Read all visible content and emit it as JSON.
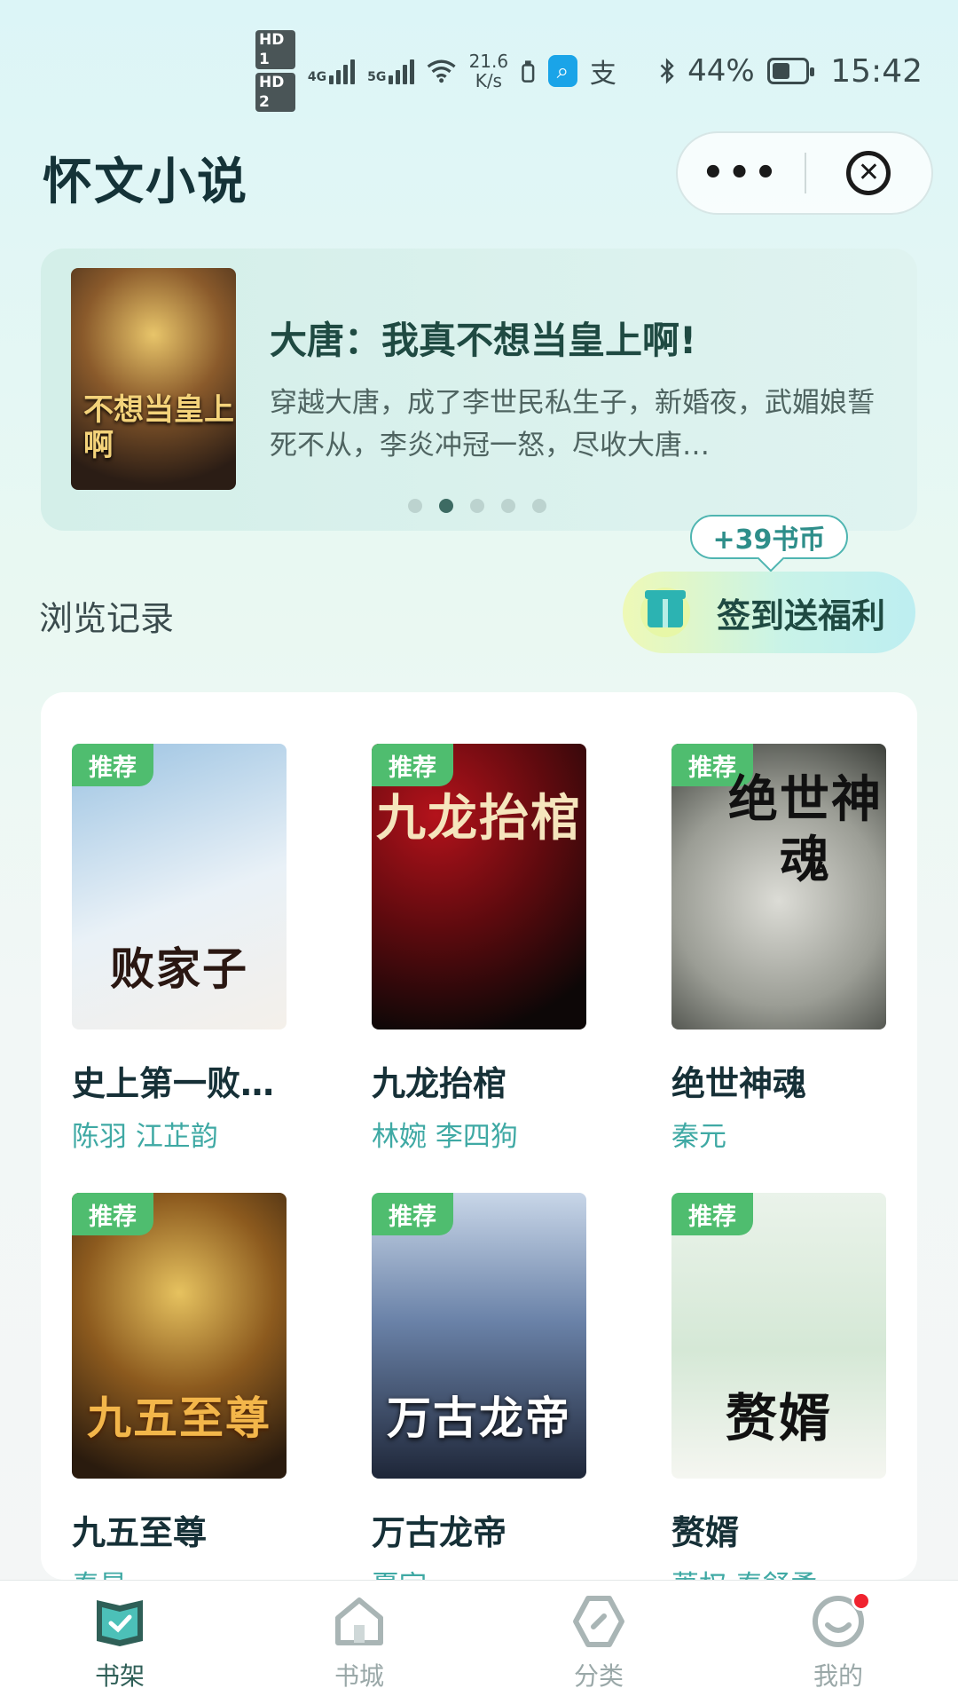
{
  "status_bar": {
    "hd1": "HD 1",
    "hd2": "HD 2",
    "net1": "4G",
    "net2": "5G",
    "speed_value": "21.6",
    "speed_unit": "K/s",
    "battery_text": "44%",
    "battery_level": 0.44,
    "time": "15:42",
    "icons": [
      "signal-4g-icon",
      "signal-5g-icon",
      "wifi-icon",
      "data-saver-icon",
      "search-app-icon",
      "alipay-icon",
      "bluetooth-icon",
      "battery-icon"
    ]
  },
  "header": {
    "title": "怀文小说",
    "capsule_more": "•••",
    "capsule_close": "✕"
  },
  "banner": {
    "cover_text": "不想当皇上啊",
    "title": "大唐：我真不想当皇上啊!",
    "description": "穿越大唐，成了李世民私生子，新婚夜，武媚娘誓死不从，李炎冲冠一怒，尽收大唐…",
    "dots_total": 5,
    "active_dot": 1
  },
  "history_label": "浏览记录",
  "signin": {
    "coin_tip": "+39书币",
    "label": "签到送福利"
  },
  "books": [
    {
      "tag": "推荐",
      "cover_text": "败家子",
      "title": "史上第一败…",
      "author": "陈羽 江芷韵"
    },
    {
      "tag": "推荐",
      "cover_text": "九龙抬棺",
      "title": "九龙抬棺",
      "author": "林婉 李四狗"
    },
    {
      "tag": "推荐",
      "cover_text": "绝世神魂",
      "title": "绝世神魂",
      "author": "秦元"
    },
    {
      "tag": "推荐",
      "cover_text": "九五至尊",
      "title": "九五至尊",
      "author": "秦昊"
    },
    {
      "tag": "推荐",
      "cover_text": "万古龙帝",
      "title": "万古龙帝",
      "author": "夏宇"
    },
    {
      "tag": "推荐",
      "cover_text": "赘婿",
      "title": "赘婿",
      "author": "萧权 秦舒柔"
    }
  ],
  "tabbar": {
    "tabs": [
      {
        "label": "书架",
        "icon": "bookshelf-icon",
        "active": true
      },
      {
        "label": "书城",
        "icon": "home-icon",
        "active": false
      },
      {
        "label": "分类",
        "icon": "category-icon",
        "active": false
      },
      {
        "label": "我的",
        "icon": "profile-icon",
        "active": false
      }
    ]
  },
  "colors": {
    "accent": "#3fa9a4",
    "tag_green": "#4fbd6f",
    "active_tab": "#2f5f57",
    "badge_red": "#f0232f"
  }
}
